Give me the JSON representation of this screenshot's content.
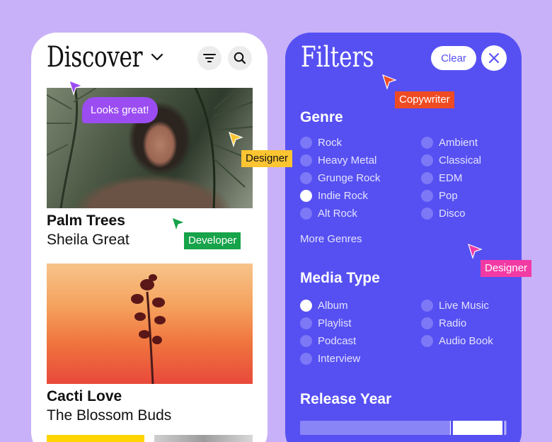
{
  "discover": {
    "title": "Discover",
    "items": [
      {
        "title": "Palm Trees",
        "artist": "Sheila Great"
      },
      {
        "title": "Cacti Love",
        "artist": "The Blossom Buds"
      }
    ]
  },
  "filters": {
    "title": "Filters",
    "clear_label": "Clear",
    "genre": {
      "heading": "Genre",
      "col1": [
        {
          "label": "Rock",
          "selected": false
        },
        {
          "label": "Heavy Metal",
          "selected": false
        },
        {
          "label": "Grunge Rock",
          "selected": false
        },
        {
          "label": "Indie Rock",
          "selected": true
        },
        {
          "label": "Alt Rock",
          "selected": false
        }
      ],
      "col2": [
        {
          "label": "Ambient",
          "selected": false
        },
        {
          "label": "Classical",
          "selected": false
        },
        {
          "label": "EDM",
          "selected": false
        },
        {
          "label": "Pop",
          "selected": false
        },
        {
          "label": "Disco",
          "selected": false
        }
      ],
      "more_label": "More Genres"
    },
    "media": {
      "heading": "Media Type",
      "col1": [
        {
          "label": "Album",
          "selected": true
        },
        {
          "label": "Playlist",
          "selected": false
        },
        {
          "label": "Podcast",
          "selected": false
        },
        {
          "label": "Interview",
          "selected": false
        }
      ],
      "col2": [
        {
          "label": "Live Music",
          "selected": false
        },
        {
          "label": "Radio",
          "selected": false
        },
        {
          "label": "Audio Book",
          "selected": false
        }
      ]
    },
    "release": {
      "heading": "Release Year",
      "range": [
        0.8,
        1.0
      ]
    }
  },
  "collab": {
    "bubble": "Looks great!",
    "tags": [
      {
        "label": "Designer",
        "color": "#fcc531"
      },
      {
        "label": "Developer",
        "color": "#16a34a"
      },
      {
        "label": "Copywriter",
        "color": "#ef4b23"
      },
      {
        "label": "Designer",
        "color": "#f23aa4"
      }
    ],
    "bubble_color": "#9b4df2"
  },
  "colors": {
    "background": "#c8b1f8",
    "panel": "#5650f2",
    "option_dot": "#7d78f6"
  }
}
